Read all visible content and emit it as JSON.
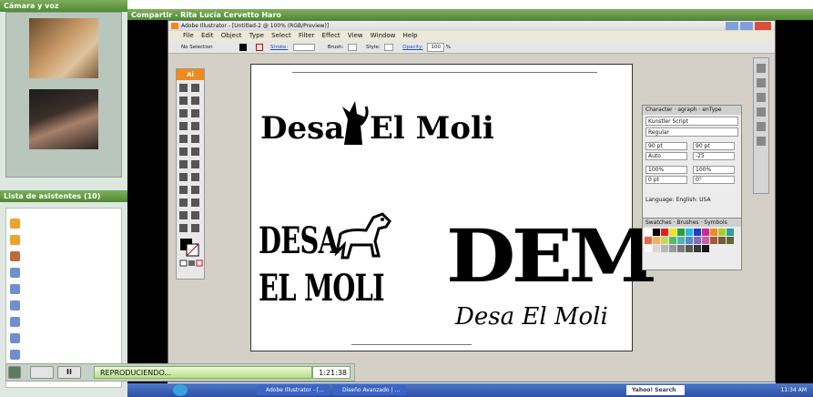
{
  "left_panel": {
    "camera_title": "Cámara y voz",
    "attendees_title": "Lista de asistentes (10)"
  },
  "share": {
    "title": "Compartir - Rita Lucía Cervetto Haro"
  },
  "illustrator": {
    "title": "Adobe Illustrator - [Untitled-2 @ 100% (RGB/Preview)]",
    "menu": [
      "File",
      "Edit",
      "Object",
      "Type",
      "Select",
      "Filter",
      "Effect",
      "View",
      "Window",
      "Help"
    ],
    "control": {
      "selection": "No Selection",
      "stroke": "Stroke:",
      "brush": "Brush:",
      "style": "Style:",
      "opacity": "Opacity:",
      "opacity_value": "100",
      "percent": "%"
    },
    "tool_label": "Ai"
  },
  "artwork": {
    "logo1_left": "Desa",
    "logo1_right": "El Moli",
    "logo2_line1": "DESA",
    "logo2_line2": "EL MOLI",
    "logo3_big": "DEM",
    "logo3_script": "Desa El Moli"
  },
  "character_panel": {
    "tabs": [
      "Character",
      "agraph",
      "enType"
    ],
    "font": "Kunstler Script",
    "style": "Regular",
    "size": "90 pt",
    "leading": "90 pt",
    "kerning": "Auto",
    "tracking": "-25",
    "hscale": "100%",
    "vscale": "100%",
    "baseline": "0 pt",
    "rotation": "0°",
    "language_label": "Language:",
    "language": "English: USA"
  },
  "swatches_panel": {
    "tabs": [
      "Swatches",
      "Brushes",
      "Symbols"
    ]
  },
  "playback": {
    "status": "REPRODUCIENDO...",
    "time": "1:21:38"
  },
  "taskbar": {
    "items": [
      "Adobe Illustrator - [...",
      "Diseño Avanzado | ..."
    ],
    "search": "Yahoo! Search",
    "clock": "11:34 AM"
  },
  "colors": {
    "green": "#4f8a33",
    "ai_orange": "#f08a1c",
    "taskbar": "#2d4fa4"
  }
}
